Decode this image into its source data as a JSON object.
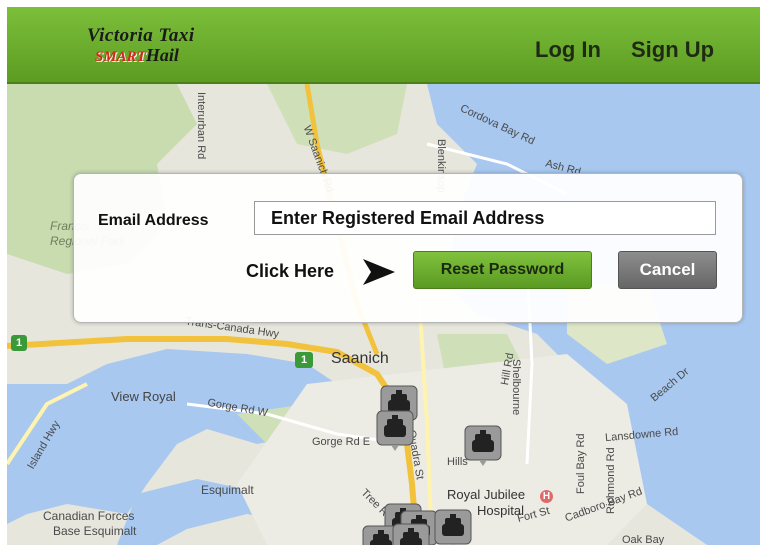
{
  "header": {
    "logo_line1": "Victoria Taxi",
    "logo_smart": "SMART",
    "logo_hail": "Hail",
    "login": "Log In",
    "signup": "Sign Up"
  },
  "dialog": {
    "email_label": "Email Address",
    "email_placeholder": "Enter Registered Email Address",
    "click_here": "Click Here",
    "reset_button": "Reset Password",
    "cancel_button": "Cancel"
  },
  "map": {
    "labels": {
      "saanich": "Saanich",
      "view_royal": "View Royal",
      "esquimalt": "Esquimalt",
      "canadian_forces": "Canadian Forces",
      "base_esquimalt": "Base Esquimalt",
      "royal_jubilee": "Royal Jubilee",
      "hospital": "Hospital",
      "trans_canada": "Trans-Canada Hwy",
      "gorge_rd_w": "Gorge Rd W",
      "gorge_rd_e": "Gorge Rd E",
      "quadra_st": "Quadra St",
      "shelbourne": "Shelbourne",
      "lansdowne_rd": "Lansdowne Rd",
      "foul_bay_rd": "Foul Bay Rd",
      "richmond_rd": "Richmond Rd",
      "beach_dr": "Beach Dr",
      "cadboro_bay_rd": "Cadboro Bay Rd",
      "oak_bay": "Oak Bay",
      "island_hwy": "Island Hwy",
      "cordova_bay_rd": "Cordova Bay Rd",
      "interurban_rd": "Interurban Rd",
      "w_saanich_rd": "W Saanich Rd",
      "blenkinsop": "Blenkinsop",
      "ash_rd": "Ash Rd",
      "francis": "Francis",
      "regional_park": "Regional Park",
      "hwy1": "1",
      "hills": "Hills",
      "hill_rd": "Hill Rd",
      "tree_rd": "Tree Rd",
      "fort_st": "Fort St"
    },
    "taxi_count": 8
  },
  "colors": {
    "header_green": "#6aaa2e",
    "reset_green": "#6aab2c",
    "cancel_gray": "#777777",
    "water": "#a8c8f0",
    "land": "#e6e6dd"
  }
}
